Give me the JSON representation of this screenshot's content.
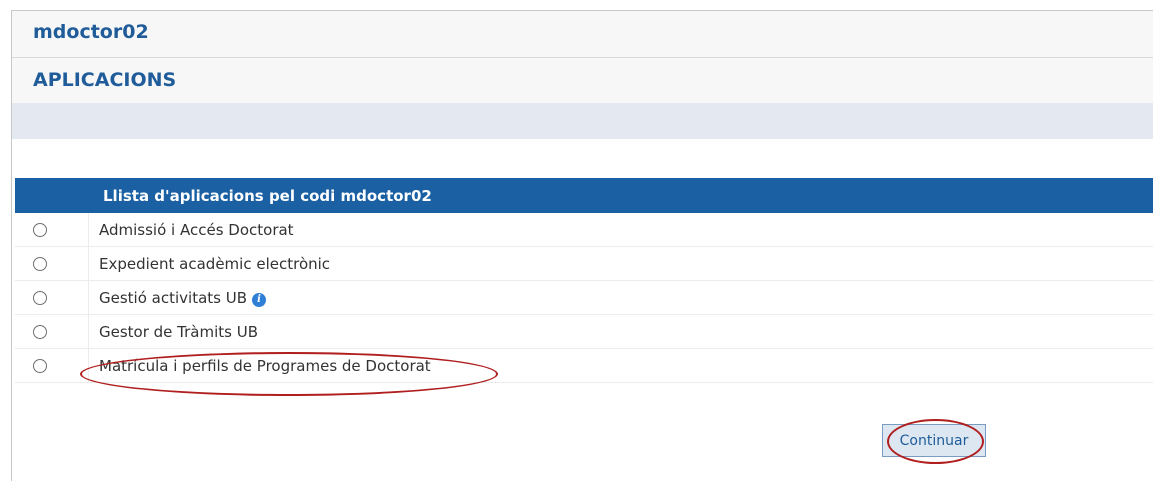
{
  "header": {
    "username": "mdoctor02"
  },
  "section": {
    "title": "APLICACIONS"
  },
  "table": {
    "heading": "Llista d'aplicacions pel codi mdoctor02",
    "rows": [
      {
        "label": "Admissió i Accés Doctorat"
      },
      {
        "label": "Expedient acadèmic electrònic"
      },
      {
        "label": "Gestió activitats UB",
        "info_icon": "info-icon"
      },
      {
        "label": "Gestor de Tràmits UB"
      },
      {
        "label": "Matrícula i perfils de Programes de Doctorat"
      }
    ]
  },
  "actions": {
    "continue_label": "Continuar"
  },
  "colors": {
    "accent": "#1a60a3",
    "title": "#1f5c99",
    "highlight": "#b01e1e"
  }
}
